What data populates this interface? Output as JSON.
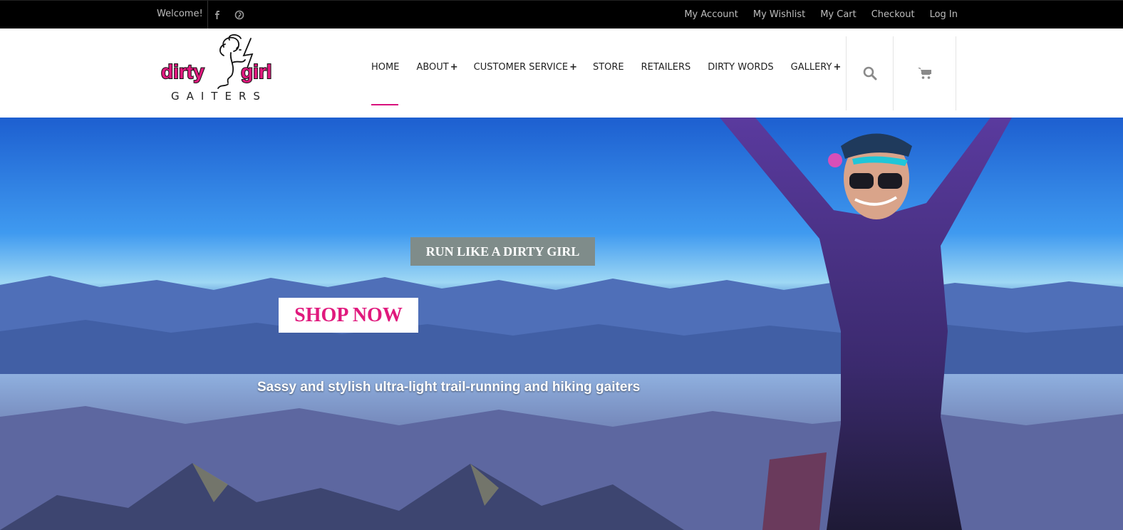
{
  "topbar": {
    "welcome": "Welcome!",
    "social": [
      {
        "icon": "facebook-icon",
        "glyph": "f"
      },
      {
        "icon": "pinterest-icon",
        "glyph": "p"
      }
    ],
    "links": [
      "My Account",
      "My Wishlist",
      "My Cart",
      "Checkout",
      "Log In"
    ]
  },
  "logo": {
    "line1_left": "dirty",
    "line1_right": "girl",
    "line2": "GAITERS"
  },
  "nav": {
    "items": [
      {
        "label": "HOME",
        "plus": ""
      },
      {
        "label": "ABOUT",
        "plus": "+"
      },
      {
        "label": "CUSTOMER SERVICE",
        "plus": "+"
      },
      {
        "label": "STORE",
        "plus": ""
      },
      {
        "label": "RETAILERS",
        "plus": ""
      },
      {
        "label": "DIRTY WORDS",
        "plus": ""
      },
      {
        "label": "GALLERY",
        "plus": "+"
      }
    ]
  },
  "header_icons": [
    "search-icon",
    "cart-icon"
  ],
  "hero": {
    "tagline": "RUN LIKE A DIRTY GIRL",
    "cta": "SHOP NOW",
    "subline": "Sassy and stylish ultra-light trail-running and hiking gaiters"
  },
  "colors": {
    "accent": "#d8117d",
    "topbar": "#000000",
    "tagline_bg": "#7f8c8a"
  }
}
